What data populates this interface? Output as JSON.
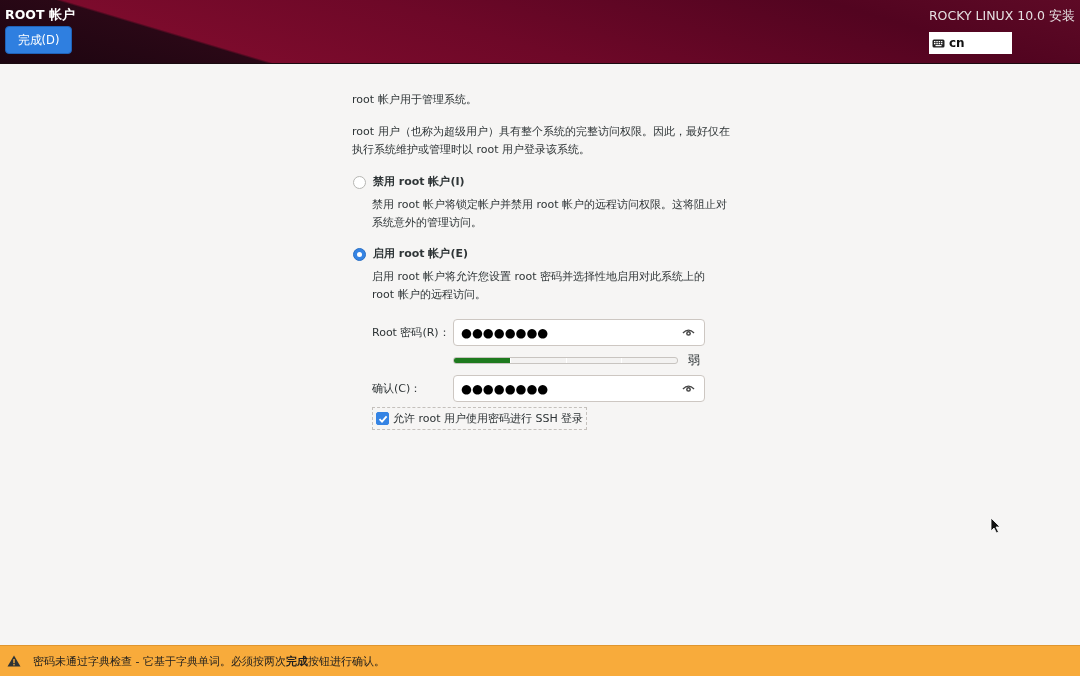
{
  "header": {
    "title": "ROOT 帐户",
    "done_button": "完成(D)",
    "product": "ROCKY LINUX 10.0 安装",
    "keyboard_layout": "cn"
  },
  "intro": [
    "root 帐户用于管理系统。",
    "root 用户（也称为超级用户）具有整个系统的完整访问权限。因此，最好仅在执行系统维护或管理时以 root 用户登录该系统。"
  ],
  "options": [
    {
      "label": "禁用 root 帐户(I)",
      "description": "禁用 root 帐户将锁定帐户并禁用 root 帐户的远程访问权限。这将阻止对系统意外的管理访问。",
      "selected": false
    },
    {
      "label": "启用 root 帐户(E)",
      "description": "启用 root 帐户将允许您设置 root 密码并选择性地启用对此系统上的 root 帐户的远程访问。",
      "selected": true
    }
  ],
  "password_form": {
    "password_label": "Root 密码(R)：",
    "password_value": "●●●●●●●●",
    "strength": {
      "level": 0.25,
      "reading": "弱"
    },
    "confirm_label": "确认(C)：",
    "confirm_value": "●●●●●●●●",
    "ssh_option": {
      "label": "允许 root 用户使用密码进行 SSH 登录",
      "checked": true
    }
  },
  "warning_bar": {
    "message": "密码未通过字典检查 - 它基于字典单词。必须按两次**完成**按钮进行确认。"
  }
}
